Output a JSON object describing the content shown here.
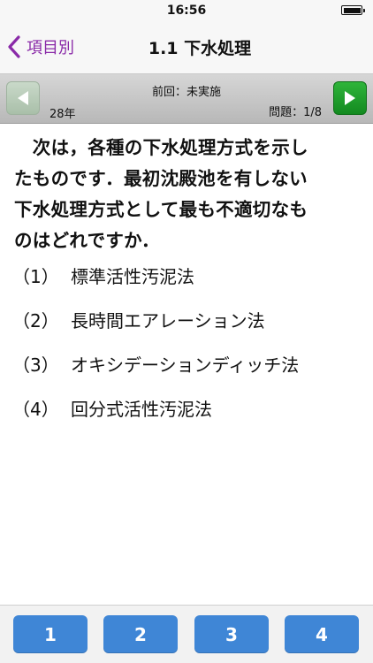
{
  "status_bar": {
    "time": "16:56"
  },
  "nav": {
    "back_label": "項目別",
    "title": "1.1 下水処理"
  },
  "toolbar": {
    "year": "28年",
    "prev_result": "前回：未実施",
    "question_counter": "問題：1/8"
  },
  "question": {
    "lines": [
      "　次は，各種の下水処理方式を示し",
      "たものです．最初沈殿池を有しない",
      "下水処理方式として最も不適切なも",
      "のはどれですか．"
    ]
  },
  "choices": [
    {
      "num": "（1）",
      "text": "標準活性汚泥法"
    },
    {
      "num": "（2）",
      "text": "長時間エアレーション法"
    },
    {
      "num": "（3）",
      "text": "オキシデーションディッチ法"
    },
    {
      "num": "（4）",
      "text": "回分式活性汚泥法"
    }
  ],
  "answer_buttons": [
    "1",
    "2",
    "3",
    "4"
  ],
  "colors": {
    "accent": "#8a2aa8",
    "next_button": "#1f9e2c",
    "answer_button": "#3f86d6"
  }
}
